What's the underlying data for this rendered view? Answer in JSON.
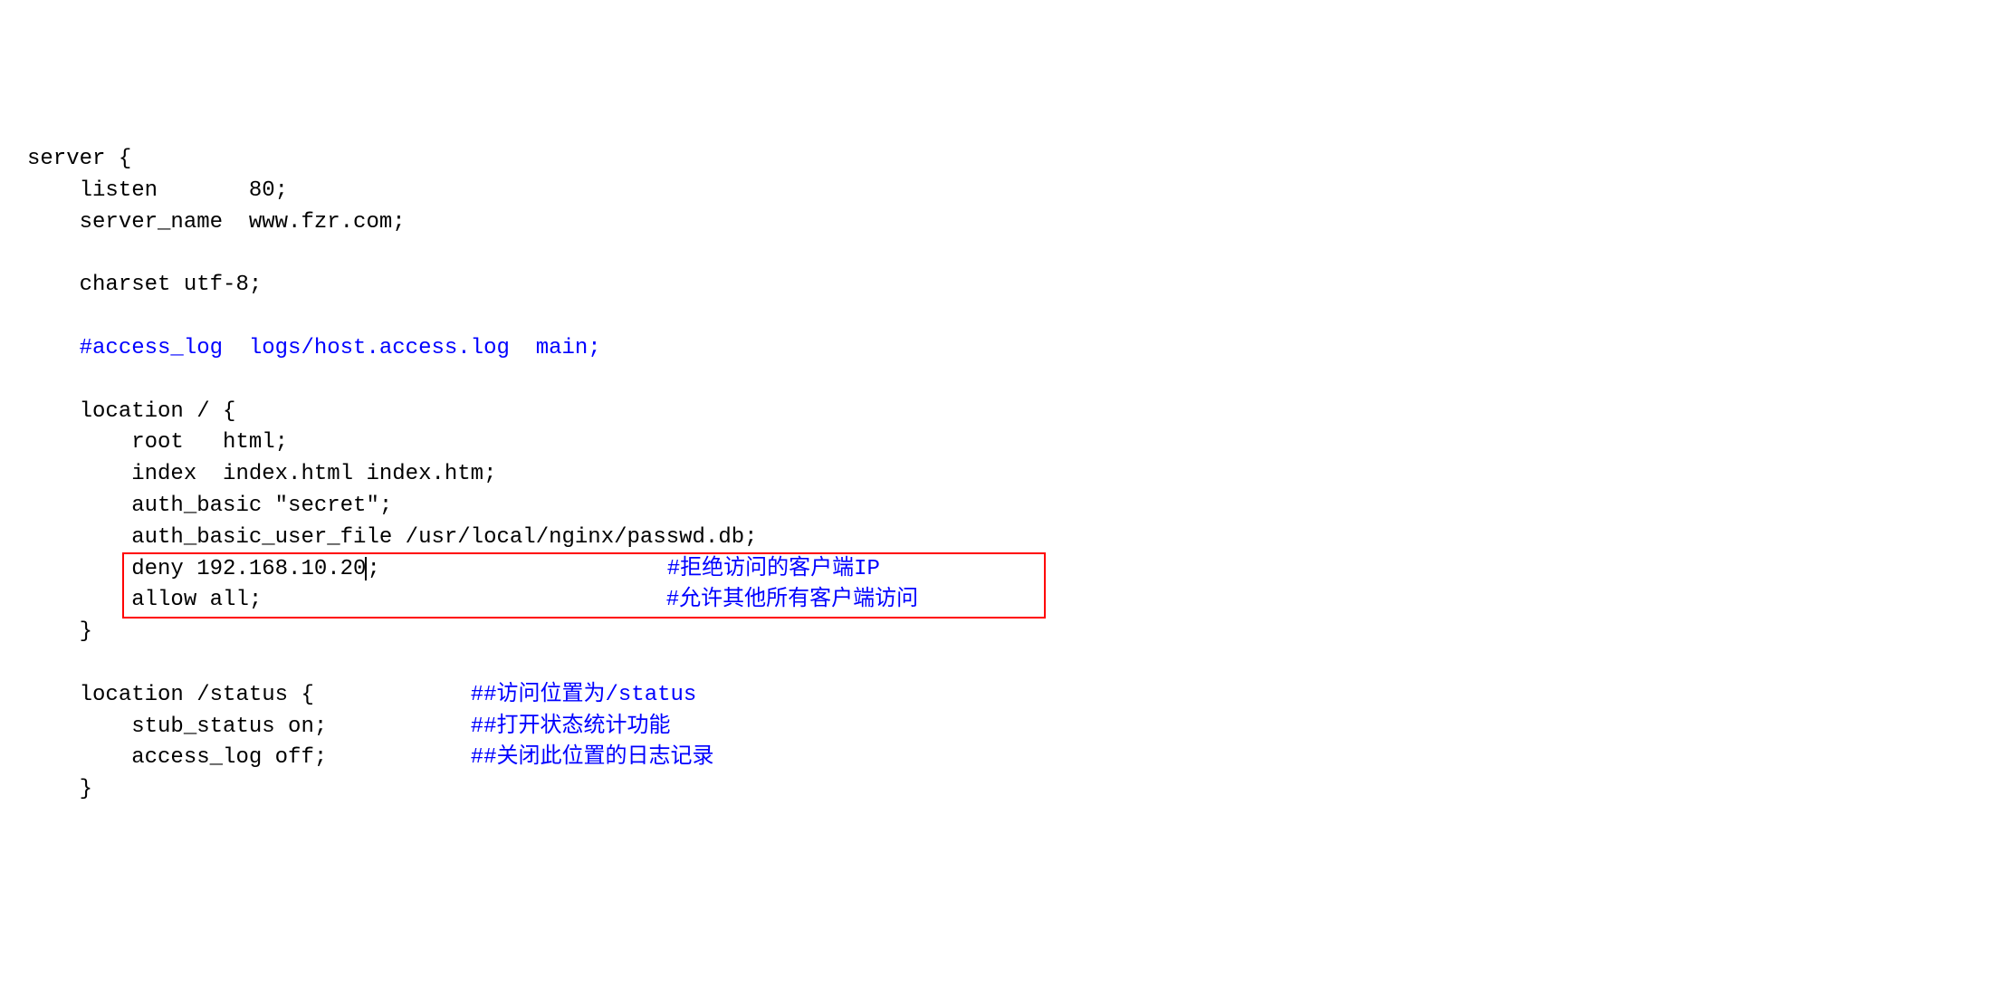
{
  "code": {
    "lines": [
      {
        "indent": 0,
        "text": "server {",
        "comment": ""
      },
      {
        "indent": 1,
        "text": "listen       80;",
        "comment": ""
      },
      {
        "indent": 1,
        "text": "server_name  www.fzr.com;",
        "comment": ""
      },
      {
        "indent": 0,
        "text": "",
        "comment": ""
      },
      {
        "indent": 1,
        "text": "charset utf-8;",
        "comment": ""
      },
      {
        "indent": 0,
        "text": "",
        "comment": ""
      },
      {
        "indent": 1,
        "text": "",
        "comment": "#access_log  logs/host.access.log  main;"
      },
      {
        "indent": 0,
        "text": "",
        "comment": ""
      },
      {
        "indent": 1,
        "text": "location / {",
        "comment": ""
      },
      {
        "indent": 2,
        "text": "root   html;",
        "comment": ""
      },
      {
        "indent": 2,
        "text": "index  index.html index.htm;",
        "comment": ""
      },
      {
        "indent": 2,
        "text": "auth_basic \"secret\";",
        "comment": ""
      },
      {
        "indent": 2,
        "text": "auth_basic_user_file /usr/local/nginx/passwd.db;",
        "comment": ""
      },
      {
        "indent": 2,
        "text": "deny 192.168.10.20",
        "cursor": true,
        "afterCursor": ";",
        "commentPad": "                      ",
        "comment": "#拒绝访问的客户端IP"
      },
      {
        "indent": 2,
        "text": "allow all;",
        "commentPad": "                               ",
        "comment": "#允许其他所有客户端访问"
      },
      {
        "indent": 1,
        "text": "}",
        "comment": ""
      },
      {
        "indent": 0,
        "text": "",
        "comment": ""
      },
      {
        "indent": 1,
        "text": "location /status {",
        "commentPad": "            ",
        "comment": "##访问位置为/status"
      },
      {
        "indent": 2,
        "text": "stub_status on;",
        "commentPad": "           ",
        "comment": "##打开状态统计功能"
      },
      {
        "indent": 2,
        "text": "access_log off;",
        "commentPad": "           ",
        "comment": "##关闭此位置的日志记录"
      },
      {
        "indent": 1,
        "text": "}",
        "comment": ""
      }
    ]
  },
  "highlight": {
    "startLine": 13,
    "endLine": 14
  }
}
